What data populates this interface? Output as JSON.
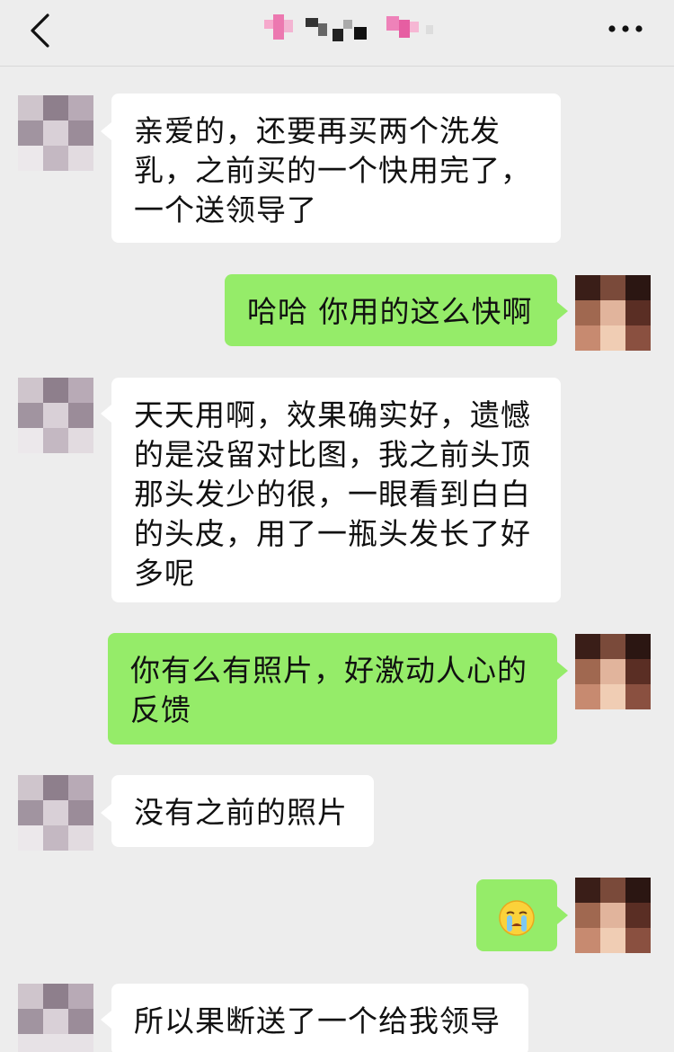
{
  "header": {
    "title": "",
    "back_icon": "chevron-left-icon",
    "more_icon": "more-dots-icon"
  },
  "messages": [
    {
      "side": "left",
      "text": "亲爱的，还要再买两个洗发乳，之前买的一个快用完了，一个送领导了"
    },
    {
      "side": "right",
      "text": "哈哈 你用的这么快啊"
    },
    {
      "side": "left",
      "text": "天天用啊，效果确实好，遗憾的是没留对比图，我之前头顶那头发少的很，一眼看到白白的头皮，用了一瓶头发长了好多呢"
    },
    {
      "side": "right",
      "text": "你有么有照片，好激动人心的反馈"
    },
    {
      "side": "left",
      "text": "没有之前的照片"
    },
    {
      "side": "right",
      "text": "",
      "emoji": "crying-face-icon"
    },
    {
      "side": "left",
      "text": "所以果断送了一个给我领导"
    }
  ],
  "colors": {
    "background": "#ededed",
    "bubble_left": "#ffffff",
    "bubble_right": "#95ec69"
  }
}
